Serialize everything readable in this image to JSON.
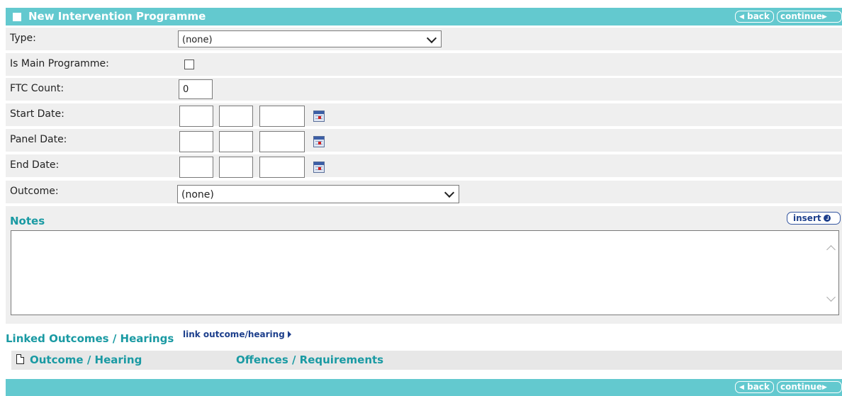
{
  "header": {
    "title": "New Intervention Programme",
    "back_label": "back",
    "continue_label": "continue"
  },
  "form": {
    "type": {
      "label": "Type:",
      "value": "(none)"
    },
    "is_main": {
      "label": "Is Main Programme:",
      "checked": false
    },
    "ftc_count": {
      "label": "FTC Count:",
      "value": "0"
    },
    "start_date": {
      "label": "Start Date:",
      "day": "",
      "month": "",
      "year": ""
    },
    "panel_date": {
      "label": "Panel Date:",
      "day": "",
      "month": "",
      "year": ""
    },
    "end_date": {
      "label": "End Date:",
      "day": "",
      "month": "",
      "year": ""
    },
    "outcome": {
      "label": "Outcome:",
      "value": "(none)"
    }
  },
  "notes": {
    "heading": "Notes",
    "insert_label": "insert",
    "value": ""
  },
  "linked": {
    "heading": "Linked Outcomes / Hearings",
    "link_label": "link outcome/hearing",
    "columns": [
      "Outcome / Hearing",
      "Offences / Requirements"
    ]
  },
  "footer": {
    "back_label": "back",
    "continue_label": "continue"
  },
  "colors": {
    "bar": "#63c9cf",
    "heading": "#1a9aa3",
    "link": "#1d3f8c",
    "row_bg": "#efefef"
  }
}
